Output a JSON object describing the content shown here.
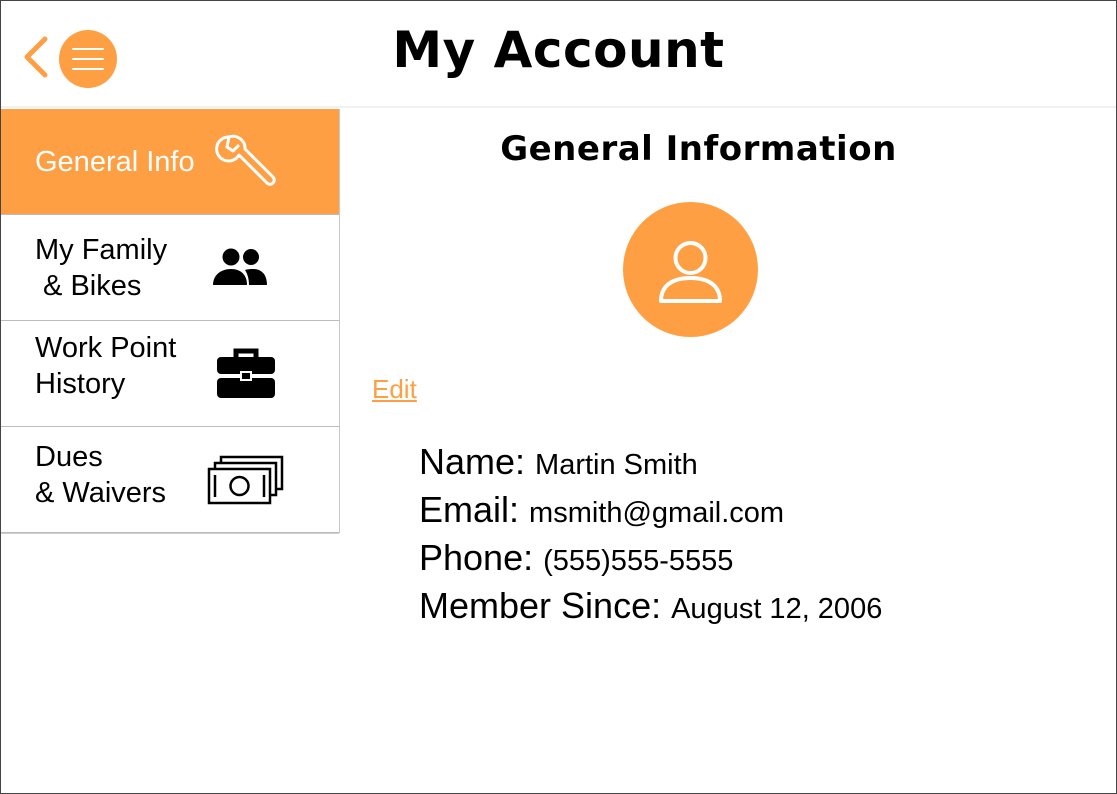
{
  "header": {
    "title": "My Account",
    "back_icon": "chevron-left-icon",
    "menu_icon": "hamburger-menu-icon",
    "accent_color": "#ff9f43"
  },
  "sidebar": {
    "items": [
      {
        "label": "General Info",
        "icon": "wrench-icon",
        "active": true
      },
      {
        "label": "My Family\n & Bikes",
        "icon": "people-icon",
        "active": false
      },
      {
        "label": "Work Point\nHistory",
        "icon": "briefcase-icon",
        "active": false
      },
      {
        "label": "Dues\n& Waivers",
        "icon": "money-icon",
        "active": false
      }
    ]
  },
  "main": {
    "section_title": "General Information",
    "avatar_icon": "user-icon",
    "edit_label": "Edit",
    "fields": [
      {
        "label": "Name:",
        "value": "Martin Smith"
      },
      {
        "label": "Email:",
        "value": "msmith@gmail.com"
      },
      {
        "label": "Phone:",
        "value": "(555)555-5555"
      },
      {
        "label": "Member Since:",
        "value": "August 12, 2006"
      }
    ]
  }
}
